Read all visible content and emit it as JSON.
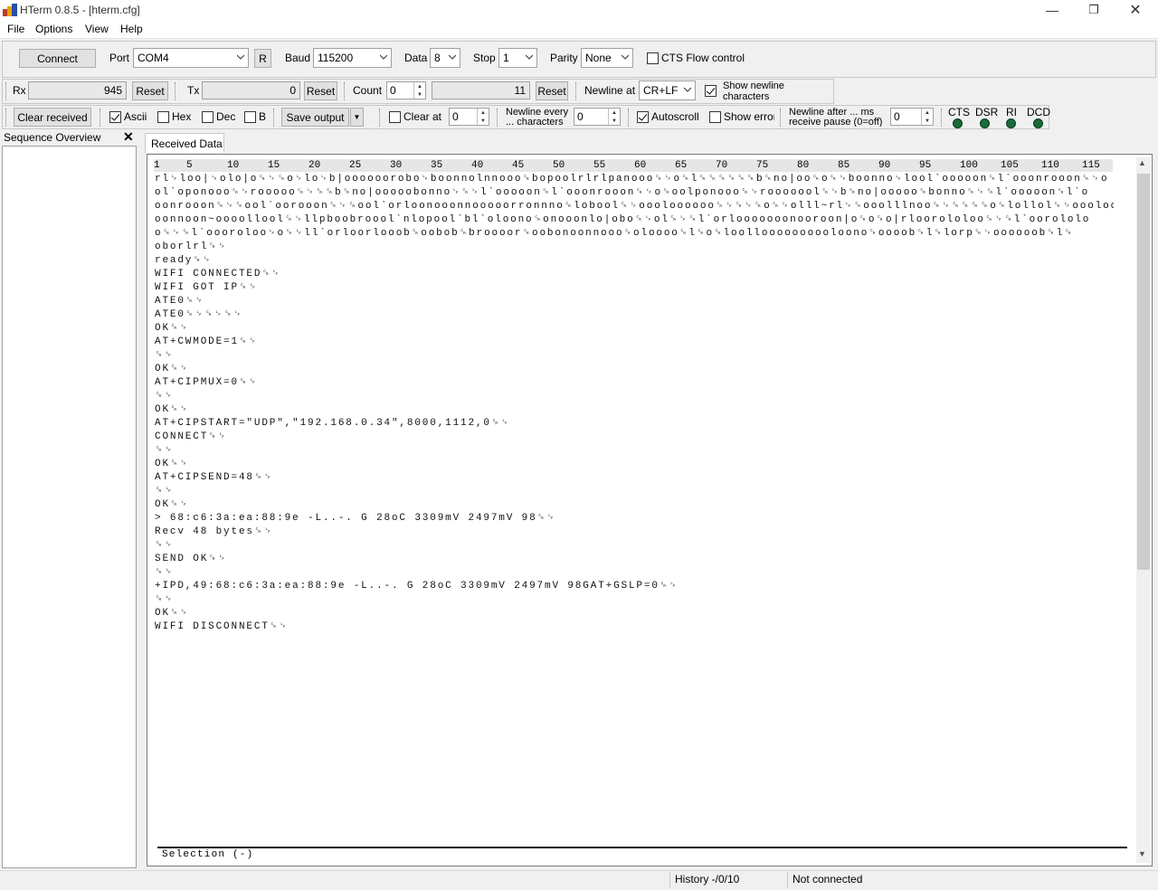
{
  "window": {
    "title": "HTerm 0.8.5 - [hterm.cfg]"
  },
  "menu": [
    "File",
    "Options",
    "View",
    "Help"
  ],
  "connection": {
    "connect_label": "Connect",
    "port_label": "Port",
    "port_value": "COM4",
    "r_label": "R",
    "baud_label": "Baud",
    "baud_value": "115200",
    "data_label": "Data",
    "data_value": "8",
    "stop_label": "Stop",
    "stop_value": "1",
    "parity_label": "Parity",
    "parity_value": "None",
    "cts_label": "CTS Flow control"
  },
  "counters": {
    "rx_label": "Rx",
    "rx_value": "945",
    "rx_reset": "Reset",
    "tx_label": "Tx",
    "tx_value": "0",
    "tx_reset": "Reset",
    "count_label": "Count",
    "count_value": "0",
    "count_total": "11",
    "count_reset": "Reset",
    "newline_label": "Newline at",
    "newline_value": "CR+LF",
    "show_newline_line1": "Show newline",
    "show_newline_line2": "characters"
  },
  "display": {
    "clear_received": "Clear received",
    "ascii": "Ascii",
    "hex": "Hex",
    "dec": "Dec",
    "bin": "B",
    "save_output": "Save output",
    "clear_at": "Clear at",
    "clear_at_value": "0",
    "newline_every_line1": "Newline every",
    "newline_every_line2": "... characters",
    "newline_every_value": "0",
    "autoscroll": "Autoscroll",
    "show_errors": "Show errors",
    "newline_after_line1": "Newline after ... ms",
    "newline_after_line2": "receive pause (0=off)",
    "newline_after_value": "0",
    "leds": [
      "CTS",
      "DSR",
      "RI",
      "DCD"
    ]
  },
  "sequence_overview": {
    "title": "Sequence Overview"
  },
  "received": {
    "tab": "Received Data",
    "ruler": [
      "1",
      "5",
      "10",
      "15",
      "20",
      "25",
      "30",
      "35",
      "40",
      "45",
      "50",
      "55",
      "60",
      "65",
      "70",
      "75",
      "80",
      "85",
      "90",
      "95",
      "100",
      "105",
      "110",
      "115"
    ],
    "lines": [
      "rl␊loo|␊olo|o␍␊␍o␊lo␊b|oooooorobo␊boonnolnnooo␍bopoolrlrlpanooo␍␊o␍l␍␍␍␍␍␍b␍no|oo␍o␍␊boonno␊lool`ooooon␍l`ooonrooon␍␊o",
      "ol`oponooo␍␊rooooo␍␊␍␍b␍no|ooooobonno␊␍␊l`ooooon␍l`ooonrooon␍␊o␍oolponooo␍␊rooooool␍␊b␍no|ooooo␍bonno␍␊␍l`ooooon␍l`o",
      "oonrooon␍␊␍ool`oorooon␍␊␍ool`orloonooonnooooorronnno␍lobool␍␊oooloooooo␍␊␍␊␍o␍␊olll~rl␊␍ooolllnoo␍␊␍␍␍␍o␍lollol␍␊ooolooo",
      "oonnoon~oooollool␍␊llpboobroool`nlopool`bl`oloono␍onooonlo|obo␍␊ol␍␊␍l`orlooooooonooroon|o␍o␍o|rloorololoo␍␊␍l`oorololo",
      "o␍␊␍l`oooroloo␊o␍␊ll`orloorlooob␍oobob␍broooor␍oobonoonnooo␍oloooo␍l␍o␍loolloooooooooloono␍oooob␍l␍lorp␍␊oooooob␍l␍",
      "oborlrl␍␊",
      "ready␍␊",
      "WIFI CONNECTED␍␊",
      "WIFI GOT IP␍␊",
      "ATE0␍␊",
      "ATE0␍␊␍␊␍␊",
      "OK␍␊",
      "AT+CWMODE=1␍␊",
      "␍␊",
      "OK␍␊",
      "AT+CIPMUX=0␍␊",
      "␍␊",
      "OK␍␊",
      "AT+CIPSTART=\"UDP\",\"192.168.0.34\",8000,1112,0␍␊",
      "CONNECT␍␊",
      "␍␊",
      "OK␍␊",
      "AT+CIPSEND=48␍␊",
      "␍␊",
      "OK␍␊",
      "> 68:c6:3a:ea:88:9e -L..-. G 28oC 3309mV 2497mV 98␍␊",
      "Recv 48 bytes␍␊",
      "␍␊",
      "SEND OK␍␊",
      "␍␊",
      "+IPD,49:68:c6:3a:ea:88:9e -L..-. G 28oC 3309mV 2497mV 98GAT+GSLP=0␍␊",
      "␍␊",
      "OK␍␊",
      "WIFI DISCONNECT␍␊"
    ],
    "selection": "Selection (-)"
  },
  "status": {
    "history": "History -/0/10",
    "connection": "Not connected"
  }
}
